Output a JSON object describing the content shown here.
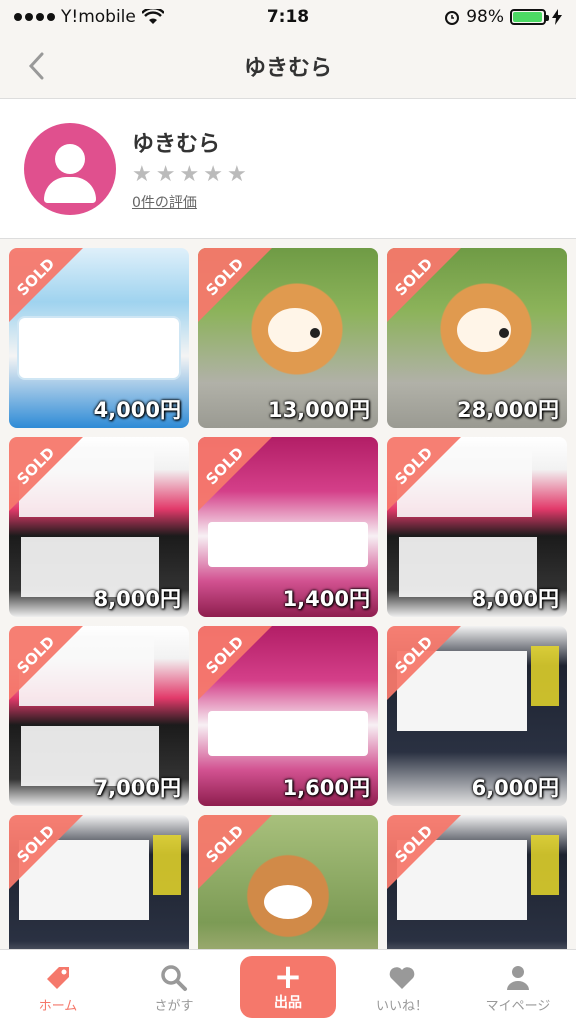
{
  "status": {
    "carrier": "Y!mobile",
    "time": "7:18",
    "battery": "98%"
  },
  "nav": {
    "title": "ゆきむら"
  },
  "profile": {
    "name": "ゆきむら",
    "stars": [
      "★",
      "★",
      "★",
      "★",
      "★"
    ],
    "reviews": "0件の評価"
  },
  "items": [
    {
      "thumb": "mask-blue",
      "sold": "SOLD",
      "price": "4,000円"
    },
    {
      "thumb": "corgi",
      "sold": "SOLD",
      "price": "13,000円"
    },
    {
      "thumb": "corgi",
      "sold": "SOLD",
      "price": "28,000円"
    },
    {
      "thumb": "mask-black",
      "sold": "SOLD",
      "price": "8,000円"
    },
    {
      "thumb": "mask-pink",
      "sold": "SOLD",
      "price": "1,400円"
    },
    {
      "thumb": "mask-black",
      "sold": "SOLD",
      "price": "8,000円"
    },
    {
      "thumb": "mask-black",
      "sold": "SOLD",
      "price": "7,000円"
    },
    {
      "thumb": "mask-pink",
      "sold": "SOLD",
      "price": "1,600円"
    },
    {
      "thumb": "mask-navy",
      "sold": "SOLD",
      "price": "6,000円"
    },
    {
      "thumb": "mask-navy",
      "sold": "SOLD",
      "price": ""
    },
    {
      "thumb": "shiba",
      "sold": "SOLD",
      "price": ""
    },
    {
      "thumb": "mask-navy",
      "sold": "SOLD",
      "price": ""
    }
  ],
  "tabs": {
    "home": "ホーム",
    "search": "さがす",
    "sell": "出品",
    "likes": "いいね！",
    "mypage": "マイページ"
  },
  "colors": {
    "accent": "#f5786b",
    "avatar": "#e0508e"
  }
}
